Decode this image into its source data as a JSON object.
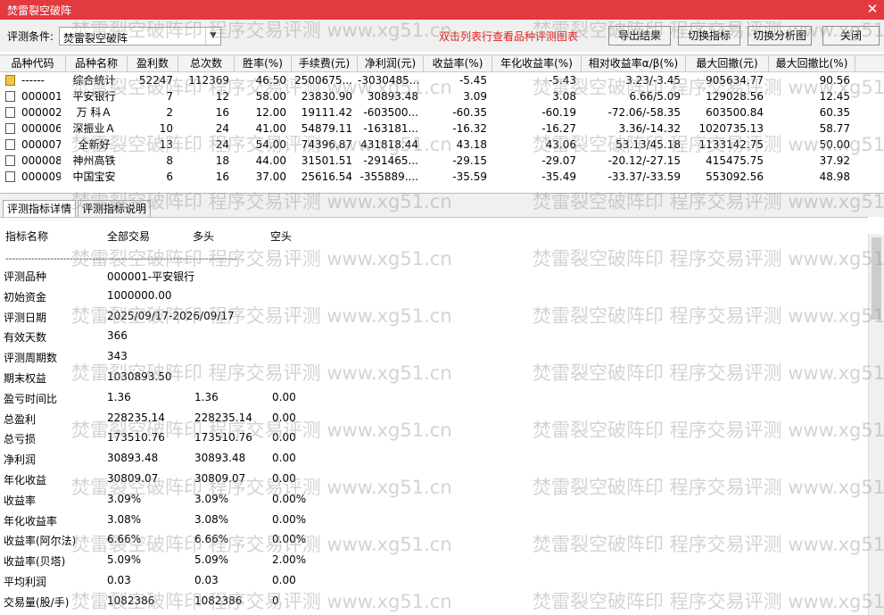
{
  "window": {
    "title": "焚雷裂空破阵",
    "close_glyph": "✕"
  },
  "toolbar": {
    "condition_label": "评测条件:",
    "condition_value": "焚雷裂空破阵",
    "hint": "双击列表行查看品种评测图表",
    "export_button": "导出结果",
    "switch_indicator_button": "切换指标",
    "switch_chart_button": "切换分析图",
    "close_button": "关闭"
  },
  "table": {
    "headers": [
      "品种代码",
      "品种名称",
      "盈利数",
      "总次数",
      "胜率(%)",
      "手续费(元)",
      "净利润(元)",
      "收益率(%)",
      "年化收益率(%)",
      "相对收益率α/β(%)",
      "最大回撤(元)",
      "最大回撤比(%)"
    ],
    "rows": [
      [
        "------",
        "综合统计",
        "52247",
        "112369",
        "46.50",
        "2500675...",
        "-3030485...",
        "-5.45",
        "-5.43",
        "3.23/-3.45",
        "905634.77",
        "90.56"
      ],
      [
        "000001",
        "平安银行",
        "7",
        "12",
        "58.00",
        "23830.90",
        "30893.48",
        "3.09",
        "3.08",
        "6.66/5.09",
        "129028.56",
        "12.45"
      ],
      [
        "000002",
        "万 科Ａ",
        "2",
        "16",
        "12.00",
        "19111.42",
        "-603500...",
        "-60.35",
        "-60.19",
        "-72.06/-58.35",
        "603500.84",
        "60.35"
      ],
      [
        "000006",
        "深振业Ａ",
        "10",
        "24",
        "41.00",
        "54879.11",
        "-163181...",
        "-16.32",
        "-16.27",
        "3.36/-14.32",
        "1020735.13",
        "58.77"
      ],
      [
        "000007",
        "全新好",
        "13",
        "24",
        "54.00",
        "74396.87",
        "431818.44",
        "43.18",
        "43.06",
        "53.13/45.18",
        "1133142.75",
        "50.00"
      ],
      [
        "000008",
        "神州高铁",
        "8",
        "18",
        "44.00",
        "31501.51",
        "-291465...",
        "-29.15",
        "-29.07",
        "-20.12/-27.15",
        "415475.75",
        "37.92"
      ],
      [
        "000009",
        "中国宝安",
        "6",
        "16",
        "37.00",
        "25616.54",
        "-355889....",
        "-35.59",
        "-35.49",
        "-33.37/-33.59",
        "553092.56",
        "48.98"
      ]
    ]
  },
  "tabs": {
    "detail": "评测指标详情",
    "explain": "评测指标说明"
  },
  "detail": {
    "header": {
      "name": "指标名称",
      "all": "全部交易",
      "long": "多头",
      "short": "空头"
    },
    "separator": "------------------------------------------------------------------------",
    "lines": [
      {
        "label": "评测品种",
        "all": "000001-平安银行",
        "long": "",
        "short": ""
      },
      {
        "label": "初始资金",
        "all": "1000000.00",
        "long": "",
        "short": ""
      },
      {
        "label": "评测日期",
        "all": "2025/09/17-2026/09/17",
        "long": "",
        "short": ""
      },
      {
        "label": "有效天数",
        "all": "366",
        "long": "",
        "short": ""
      },
      {
        "label": "评测周期数",
        "all": "343",
        "long": "",
        "short": ""
      },
      {
        "label": "期末权益",
        "all": "1030893.50",
        "long": "",
        "short": ""
      },
      {
        "label": "盈亏时间比",
        "all": "1.36",
        "long": "1.36",
        "short": "0.00"
      },
      {
        "label": "总盈利",
        "all": "228235.14",
        "long": "228235.14",
        "short": "0.00"
      },
      {
        "label": "总亏损",
        "all": "173510.76",
        "long": "173510.76",
        "short": "0.00"
      },
      {
        "label": "净利润",
        "all": "30893.48",
        "long": "30893.48",
        "short": "0.00"
      },
      {
        "label": "年化收益",
        "all": "30809.07",
        "long": "30809.07",
        "short": "0.00"
      },
      {
        "label": "收益率",
        "all": "3.09%",
        "long": "3.09%",
        "short": "0.00%"
      },
      {
        "label": "年化收益率",
        "all": "3.08%",
        "long": "3.08%",
        "short": "0.00%"
      },
      {
        "label": "收益率(阿尔法)",
        "all": "6.66%",
        "long": "6.66%",
        "short": "0.00%"
      },
      {
        "label": "收益率(贝塔)",
        "all": "5.09%",
        "long": "5.09%",
        "short": "2.00%"
      },
      {
        "label": "平均利润",
        "all": "0.03",
        "long": "0.03",
        "short": "0.00"
      },
      {
        "label": "交易量(股/手)",
        "all": "1082386",
        "long": "1082386",
        "short": "0"
      }
    ]
  },
  "watermark": {
    "text": "焚雷裂空破阵印 程序交易评测 www.xg51.cn"
  },
  "colors": {
    "titlebar": "#e23b3f",
    "hint": "#e0211f",
    "watermark": "#969696"
  }
}
